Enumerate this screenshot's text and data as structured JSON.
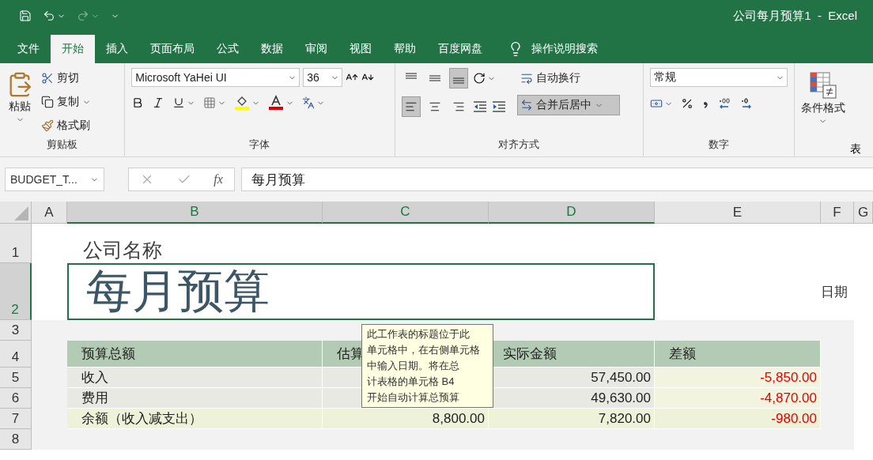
{
  "window": {
    "title": "公司每月预算1  -  Excel"
  },
  "tabs": [
    {
      "label": "文件",
      "selected": false
    },
    {
      "label": "开始",
      "selected": true
    },
    {
      "label": "插入",
      "selected": false
    },
    {
      "label": "页面布局",
      "selected": false
    },
    {
      "label": "公式",
      "selected": false
    },
    {
      "label": "数据",
      "selected": false
    },
    {
      "label": "审阅",
      "selected": false
    },
    {
      "label": "视图",
      "selected": false
    },
    {
      "label": "帮助",
      "selected": false
    },
    {
      "label": "百度网盘",
      "selected": false
    }
  ],
  "tell_me": "操作说明搜索",
  "clipboard": {
    "label": "剪贴板",
    "paste": "粘贴",
    "cut": "剪切",
    "copy": "复制",
    "format_painter": "格式刷"
  },
  "font": {
    "label": "字体",
    "name": "Microsoft YaHei UI",
    "size": "36"
  },
  "alignment": {
    "label": "对齐方式",
    "wrap_text": "自动换行",
    "merge_center": "合并后居中",
    "merge_on": true,
    "align_bottom_on": true,
    "align_left_on": true
  },
  "number": {
    "label": "数字",
    "format": "常规"
  },
  "styles": {
    "conditional_format": "条件格式",
    "next_label": "表"
  },
  "formula_bar": {
    "name_box": "BUDGET_T...",
    "fx": "fx",
    "content": "每月预算"
  },
  "columns": [
    {
      "label": "A",
      "selected": false
    },
    {
      "label": "B",
      "selected": true
    },
    {
      "label": "C",
      "selected": true
    },
    {
      "label": "D",
      "selected": true
    },
    {
      "label": "E",
      "selected": false
    },
    {
      "label": "F",
      "selected": false
    },
    {
      "label": "G",
      "selected": false
    }
  ],
  "rows": [
    {
      "label": "1",
      "selected": false
    },
    {
      "label": "2",
      "selected": true
    },
    {
      "label": "3",
      "selected": false
    },
    {
      "label": "4",
      "selected": false
    },
    {
      "label": "5",
      "selected": false
    },
    {
      "label": "6",
      "selected": false
    },
    {
      "label": "7",
      "selected": false
    },
    {
      "label": "8",
      "selected": false
    }
  ],
  "sheet": {
    "company": "公司名称",
    "title": "每月预算",
    "date_label": "日期"
  },
  "table": {
    "header": [
      "预算总额",
      "估算",
      "实际金额",
      "差额"
    ],
    "rows": [
      {
        "kind": "item",
        "label": "收入",
        "actual": "57,450.00",
        "difference": "-5,850.00"
      },
      {
        "kind": "item",
        "label": "费用",
        "actual": "49,630.00",
        "difference": "-4,870.00"
      },
      {
        "kind": "total",
        "label": "余额（收入减支出）",
        "estimated": "8,800.00",
        "actual": "7,820.00",
        "difference": "-980.00"
      }
    ]
  },
  "tooltip": {
    "lines": [
      "此工作表的标题位于此",
      "单元格中，在右侧单元格",
      "中输入日期。将在总",
      "计表格的单元格 B4",
      "开始自动计算总预算"
    ]
  }
}
